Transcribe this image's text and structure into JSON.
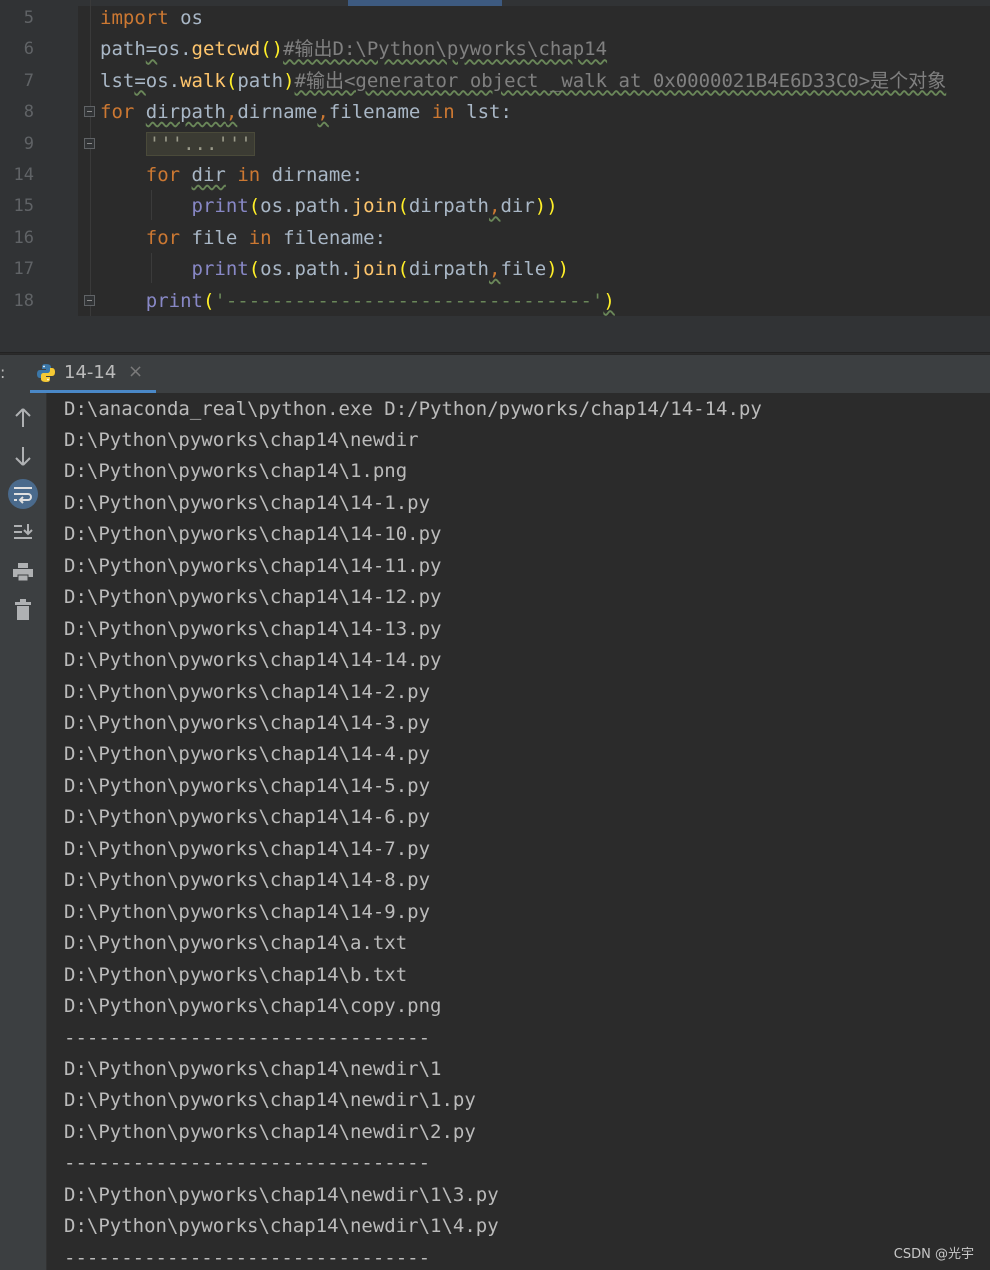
{
  "editor": {
    "lines": [
      {
        "num": "5",
        "tokens": [
          {
            "t": "import",
            "c": "kw"
          },
          {
            "t": " os",
            "c": ""
          }
        ]
      },
      {
        "num": "6",
        "tokens": [
          {
            "t": "path",
            "c": ""
          },
          {
            "t": "=",
            "c": "wavy"
          },
          {
            "t": "os.",
            "c": ""
          },
          {
            "t": "getcwd",
            "c": "fn"
          },
          {
            "t": "()",
            "c": "paren-hl"
          },
          {
            "t": "#输出D:\\Python\\pyworks\\chap14",
            "c": "cmt wavy"
          }
        ]
      },
      {
        "num": "7",
        "tokens": [
          {
            "t": "lst",
            "c": ""
          },
          {
            "t": "=",
            "c": "wavy"
          },
          {
            "t": "os.",
            "c": ""
          },
          {
            "t": "walk",
            "c": "fn"
          },
          {
            "t": "(",
            "c": "paren-hl"
          },
          {
            "t": "path",
            "c": ""
          },
          {
            "t": ")",
            "c": "paren-hl"
          },
          {
            "t": "#输出<generator object _walk at 0x0000021B4E6D33C0>是个对象",
            "c": "cmt wavy"
          }
        ]
      },
      {
        "num": "8",
        "tokens": [
          {
            "t": "for",
            "c": "kw"
          },
          {
            "t": " ",
            "c": ""
          },
          {
            "t": "dirpath",
            "c": "wavy"
          },
          {
            "t": ",",
            "c": "kw wavy"
          },
          {
            "t": "dirname",
            "c": ""
          },
          {
            "t": ",",
            "c": "kw wavy"
          },
          {
            "t": "filename",
            "c": ""
          },
          {
            "t": " in ",
            "c": "kw"
          },
          {
            "t": "lst:",
            "c": ""
          }
        ]
      },
      {
        "num": "9",
        "tokens": [
          {
            "t": "    ",
            "c": ""
          },
          {
            "t": "'''...'''",
            "c": "folded"
          }
        ]
      },
      {
        "num": "14",
        "tokens": [
          {
            "t": "    ",
            "c": ""
          },
          {
            "t": "for",
            "c": "kw"
          },
          {
            "t": " ",
            "c": ""
          },
          {
            "t": "dir",
            "c": "wavy"
          },
          {
            "t": " in ",
            "c": "kw"
          },
          {
            "t": "dirname:",
            "c": ""
          }
        ]
      },
      {
        "num": "15",
        "tokens": [
          {
            "t": "        ",
            "c": ""
          },
          {
            "t": "print",
            "c": "bi"
          },
          {
            "t": "(",
            "c": "paren-hl"
          },
          {
            "t": "os.path.",
            "c": ""
          },
          {
            "t": "join",
            "c": "fn"
          },
          {
            "t": "(",
            "c": "paren-hl"
          },
          {
            "t": "dirpath",
            "c": ""
          },
          {
            "t": ",",
            "c": "kw wavy"
          },
          {
            "t": "dir",
            "c": ""
          },
          {
            "t": "))",
            "c": "paren-hl"
          }
        ]
      },
      {
        "num": "16",
        "tokens": [
          {
            "t": "    ",
            "c": ""
          },
          {
            "t": "for",
            "c": "kw"
          },
          {
            "t": " file ",
            "c": ""
          },
          {
            "t": "in",
            "c": "kw"
          },
          {
            "t": " filename:",
            "c": ""
          }
        ]
      },
      {
        "num": "17",
        "tokens": [
          {
            "t": "        ",
            "c": ""
          },
          {
            "t": "print",
            "c": "bi"
          },
          {
            "t": "(",
            "c": "paren-hl"
          },
          {
            "t": "os.path.",
            "c": ""
          },
          {
            "t": "join",
            "c": "fn"
          },
          {
            "t": "(",
            "c": "paren-hl"
          },
          {
            "t": "dirpath",
            "c": ""
          },
          {
            "t": ",",
            "c": "kw wavy"
          },
          {
            "t": "file",
            "c": ""
          },
          {
            "t": "))",
            "c": "paren-hl"
          }
        ]
      },
      {
        "num": "18",
        "tokens": [
          {
            "t": "    ",
            "c": ""
          },
          {
            "t": "print",
            "c": "bi"
          },
          {
            "t": "(",
            "c": "paren-hl"
          },
          {
            "t": "'--------------------------------'",
            "c": "str"
          },
          {
            "t": ")",
            "c": "paren-hl wavy"
          }
        ]
      }
    ]
  },
  "run_panel": {
    "label": ":",
    "tab_name": "14-14",
    "tab_close": "×",
    "tools": [
      {
        "name": "up-arrow-icon",
        "glyph": "🡑"
      },
      {
        "name": "down-arrow-icon",
        "glyph": "🡓"
      },
      {
        "name": "soft-wrap-icon",
        "glyph": "⤶"
      },
      {
        "name": "scroll-to-end-icon",
        "glyph": "⭳"
      },
      {
        "name": "print-icon",
        "glyph": "🖶"
      },
      {
        "name": "trash-icon",
        "glyph": "🗑"
      }
    ],
    "output": [
      "D:\\anaconda_real\\python.exe D:/Python/pyworks/chap14/14-14.py",
      "D:\\Python\\pyworks\\chap14\\newdir",
      "D:\\Python\\pyworks\\chap14\\1.png",
      "D:\\Python\\pyworks\\chap14\\14-1.py",
      "D:\\Python\\pyworks\\chap14\\14-10.py",
      "D:\\Python\\pyworks\\chap14\\14-11.py",
      "D:\\Python\\pyworks\\chap14\\14-12.py",
      "D:\\Python\\pyworks\\chap14\\14-13.py",
      "D:\\Python\\pyworks\\chap14\\14-14.py",
      "D:\\Python\\pyworks\\chap14\\14-2.py",
      "D:\\Python\\pyworks\\chap14\\14-3.py",
      "D:\\Python\\pyworks\\chap14\\14-4.py",
      "D:\\Python\\pyworks\\chap14\\14-5.py",
      "D:\\Python\\pyworks\\chap14\\14-6.py",
      "D:\\Python\\pyworks\\chap14\\14-7.py",
      "D:\\Python\\pyworks\\chap14\\14-8.py",
      "D:\\Python\\pyworks\\chap14\\14-9.py",
      "D:\\Python\\pyworks\\chap14\\a.txt",
      "D:\\Python\\pyworks\\chap14\\b.txt",
      "D:\\Python\\pyworks\\chap14\\copy.png",
      "--------------------------------",
      "D:\\Python\\pyworks\\chap14\\newdir\\1",
      "D:\\Python\\pyworks\\chap14\\newdir\\1.py",
      "D:\\Python\\pyworks\\chap14\\newdir\\2.py",
      "--------------------------------",
      "D:\\Python\\pyworks\\chap14\\newdir\\1\\3.py",
      "D:\\Python\\pyworks\\chap14\\newdir\\1\\4.py",
      "--------------------------------"
    ]
  },
  "watermark": "CSDN @光宇"
}
